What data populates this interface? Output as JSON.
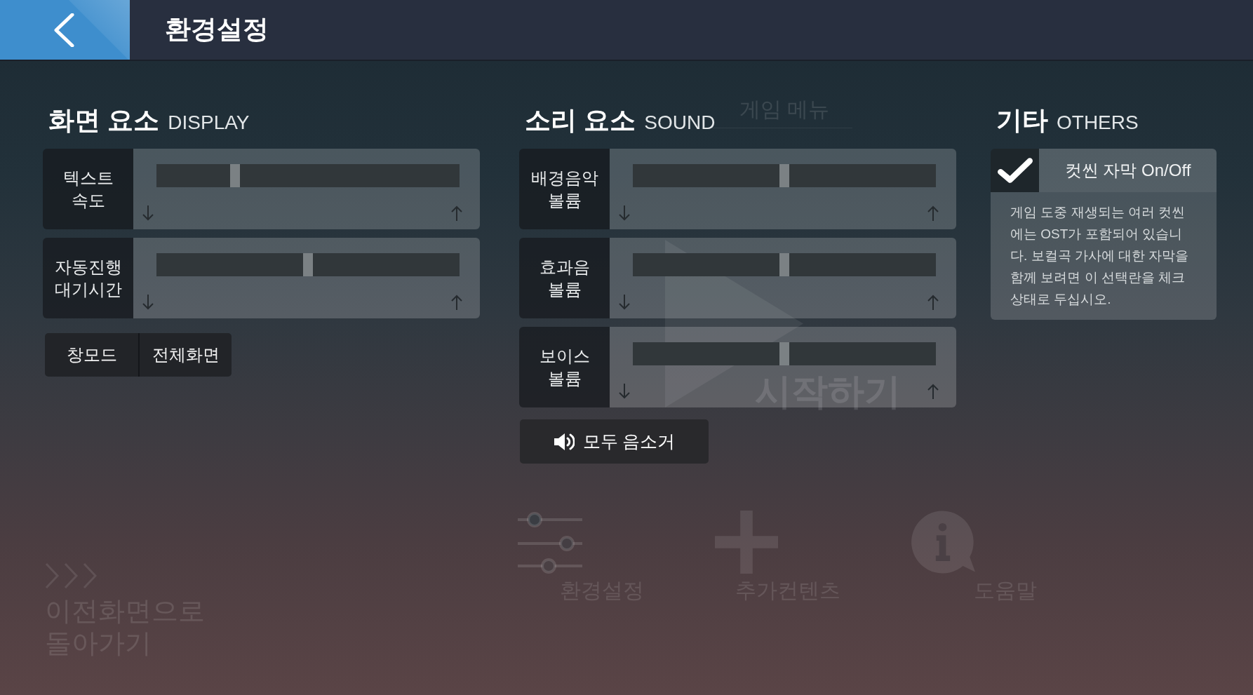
{
  "header": {
    "title": "환경설정"
  },
  "display": {
    "title": "화면 요소",
    "subtitle": "DISPLAY",
    "sliders": [
      {
        "label": "텍스트 속도",
        "level": 0.25
      },
      {
        "label": "자동진행 대기시간",
        "level": 0.5
      }
    ],
    "modes": [
      "창모드",
      "전체화면"
    ]
  },
  "sound": {
    "title": "소리 요소",
    "subtitle": "SOUND",
    "sliders": [
      {
        "label": "배경음악 볼륨",
        "level": 0.5
      },
      {
        "label": "효과음 볼륨",
        "level": 0.5
      },
      {
        "label": "보이스 볼륨",
        "level": 0.5
      }
    ],
    "mute_button": "모두 음소거"
  },
  "others": {
    "title": "기타",
    "subtitle": "OTHERS",
    "options": [
      {
        "label": "컷씬 자막 On/Off",
        "checked": true,
        "description": "게임 도중 재생되는 여러 컷씬에는 OST가 포함되어 있습니다. 보컬곡 가사에 대한 자막을 함께 보려면 이 선택란을 체크 상태로 두십시오."
      }
    ]
  },
  "background_menu": {
    "title": "게임 메뉴",
    "start": "시작하기",
    "items": [
      "환경설정",
      "추가컨텐츠",
      "도움말"
    ],
    "back": "이전화면으로 돌아가기"
  }
}
